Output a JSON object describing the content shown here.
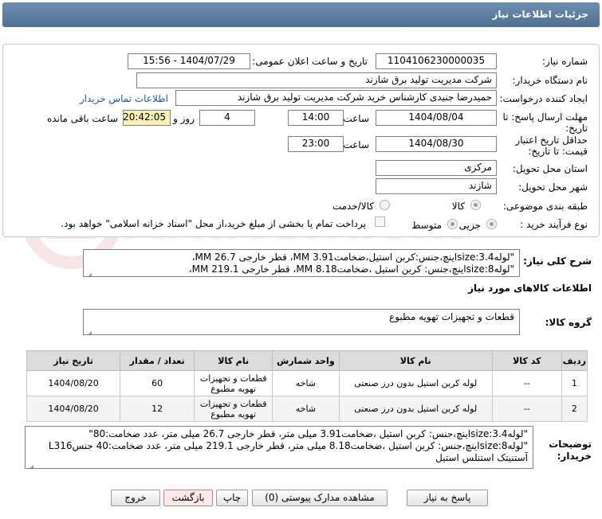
{
  "header": {
    "title": "جزئیات اطلاعات نیاز"
  },
  "form": {
    "need_number_label": "شماره نیاز:",
    "need_number": "1104106230000035",
    "announce_label": "تاریخ و ساعت اعلان عمومی:",
    "announce_value": "1404/07/29 - 15:56",
    "buyer_org_label": "نام دستگاه خریدار:",
    "buyer_org": "شرکت مدیریت تولید برق شازند",
    "requester_label": "ایجاد کننده درخواست:",
    "requester": "حمیدرضا جنیدی کارشناس خرید شرکت مدیریت تولید برق شازند",
    "contact_link": "اطلاعات تماس خریدار",
    "deadline_label": "مهلت ارسال پاسخ: تا تاریخ:",
    "deadline_date": "1404/08/04",
    "time_label": "ساعت",
    "deadline_time": "14:00",
    "days": "4",
    "days_label": "روز و",
    "remaining_time": "20:42:05",
    "remaining_label": "ساعت باقی مانده",
    "validity_label": "حداقل تاریخ اعتبار قیمت: تا تاریخ:",
    "validity_date": "1404/08/30",
    "validity_time": "23:00",
    "province_label": "استان محل تحویل:",
    "province": "مرکزی",
    "city_label": "شهر محل تحویل:",
    "city": "شازند",
    "category_label": "طبقه بندی موضوعی:",
    "category_options": [
      "کالا",
      "کالا/خدمت"
    ],
    "process_label": "نوع فرآیند خرید :",
    "process_options": [
      "جزیی",
      "متوسط"
    ],
    "payment_note": "پرداخت تمام یا بخشی از مبلغ خرید،از محل \"اسناد خزانه اسلامی\" خواهد بود."
  },
  "summary": {
    "label": "شرح کلی نیاز:",
    "line1": "\"لولهsize:3.4اینچ،جنس:کربن استیل،ضخامت3.91 MM، قطر خارجی 26.7 MM،",
    "line2": "\"لولهsize:8اینچ،جنس: کربن استیل ،ضخامت8.18 MM، قطر خارجی 219.1 MM،"
  },
  "goods": {
    "section_title": "اطلاعات کالاهای مورد نیاز",
    "group_label": "گروه کالا:",
    "group_value": "قطعات و تجهیزات تهویه مطبوع",
    "columns": [
      "ردیف",
      "کد کالا",
      "نام کالا",
      "واحد شمارش",
      "نام کالا",
      "تعداد / مقدار",
      "تاریخ نیاز"
    ],
    "rows": [
      {
        "row": "1",
        "code": "--",
        "name": "لوله کربن استیل بدون درز صنعتی",
        "unit": "شاخه",
        "group": "قطعات و تجهیزات تهویه مطبوع",
        "qty": "60",
        "date": "1404/08/20"
      },
      {
        "row": "2",
        "code": "--",
        "name": "لوله کربن استیل بدون درز صنعتی",
        "unit": "شاخه",
        "group": "قطعات و تجهیزات تهویه مطبوع",
        "qty": "12",
        "date": "1404/08/20"
      }
    ]
  },
  "buyer_notes": {
    "label": "توضیحات خریدار:",
    "line1": "\"لولهsize:3.4اینچ،جنس: کربن استیل ،ضخامت3.91 میلی متر، قطر خارجی 26.7 میلی متر، عدد ضخامت:80\"",
    "line2": "\"لولهsize:8اینچ،جنس: کربن استیل ،ضخامت8.18 میلی متر، قطر خارجی 219.1 میلی متر، عدد ضخامت:40 جنسL316",
    "line3": "آستنیتک استنلس استیل"
  },
  "buttons": {
    "reply": "پاسخ به نیاز",
    "attachments": "مشاهده مدارک پیوستی (0)",
    "print": "چاپ",
    "back": "بازگشت",
    "exit": "خروج"
  },
  "watermark": "AriaTender.net"
}
